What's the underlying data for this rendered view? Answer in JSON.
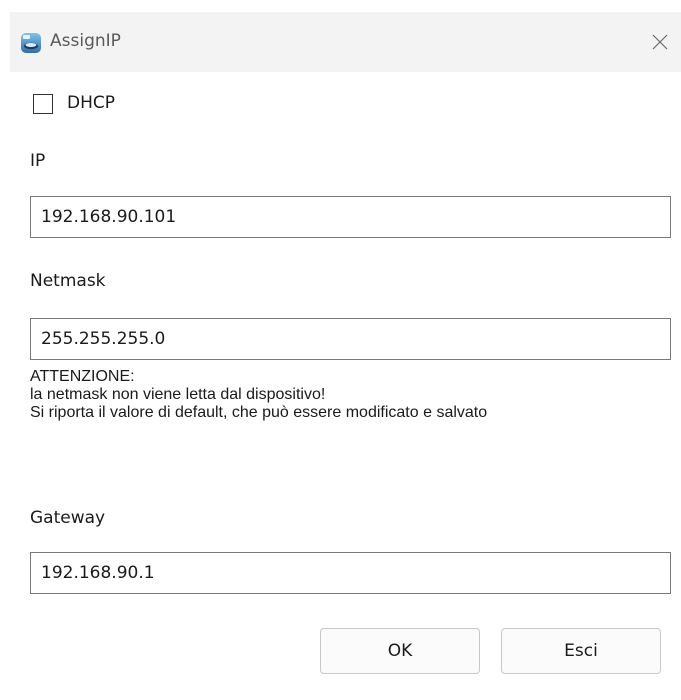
{
  "window": {
    "title": "AssignIP",
    "icon": "app-icon",
    "close_icon": "close-icon"
  },
  "dhcp": {
    "label": "DHCP",
    "checked": false
  },
  "ip": {
    "label": "IP",
    "value": "192.168.90.101"
  },
  "netmask": {
    "label": "Netmask",
    "value": "255.255.255.0"
  },
  "warning": {
    "line1": "ATTENZIONE:",
    "line2": "la netmask non viene letta dal dispositivo!",
    "line3": "Si riporta il valore di default, che può essere modificato e salvato"
  },
  "gateway": {
    "label": "Gateway",
    "value": "192.168.90.1"
  },
  "buttons": {
    "ok_label": "OK",
    "cancel_label": "Esci"
  },
  "colors": {
    "titlebar_bg": "#f3f3f3",
    "input_border": "#7a7a7a",
    "button_bg": "#fbfbfb"
  }
}
